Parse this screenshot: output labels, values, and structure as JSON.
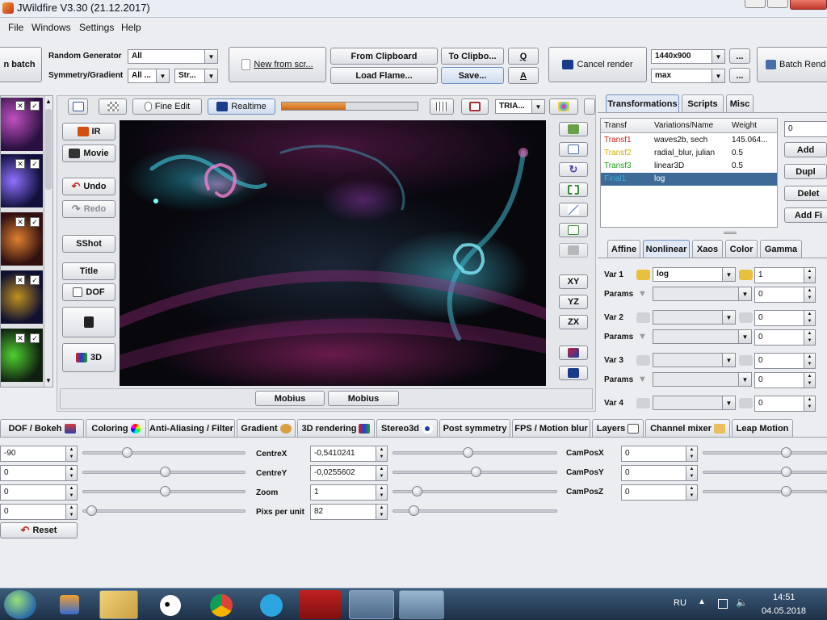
{
  "window": {
    "title": "JWildfire V3.30 (21.12.2017)"
  },
  "menu": [
    "File",
    "Windows",
    "Settings",
    "Help"
  ],
  "toolbar": {
    "batch": "n batch",
    "random_generator_label": "Random Generator",
    "random_generator_value": "All",
    "symmetry_label": "Symmetry/Gradient",
    "symmetry_value": "All ...",
    "gradient_value": "Str...",
    "new_from_script": "New from scr...",
    "from_clipboard": "From Clipboard",
    "to_clipboard": "To Clipbo...",
    "load_flame": "Load Flame...",
    "save": "Save...",
    "q": "Q",
    "a": "A",
    "cancel_render": "Cancel render",
    "resolution": "1440x900",
    "quality": "max",
    "dots": "...",
    "batch_render": "Batch Rend"
  },
  "preview_toolbar": {
    "fine_edit": "Fine Edit",
    "realtime": "Realtime",
    "progress": 0.47,
    "tria": "TRIA..."
  },
  "left_tools": {
    "ir": "IR",
    "movie": "Movie",
    "undo": "Undo",
    "redo": "Redo",
    "sshot": "SShot",
    "title": "Title",
    "dof": "DOF",
    "three_d": "3D"
  },
  "right_tools": {
    "xy": "XY",
    "yz": "YZ",
    "zx": "ZX"
  },
  "mobius": [
    "Mobius",
    "Mobius"
  ],
  "right_panel": {
    "tabs": [
      "Transformations",
      "Scripts",
      "Misc"
    ],
    "table_headers": [
      "Transf",
      "Variations/Name",
      "Weight"
    ],
    "rows": [
      {
        "transf": "Transf1",
        "name": "waves2b, sech",
        "weight": "145.064...",
        "color": "#d02020"
      },
      {
        "transf": "Transf2",
        "name": "radial_blur, julian",
        "weight": "0.5",
        "color": "#d0b000"
      },
      {
        "transf": "Transf3",
        "name": "linear3D",
        "weight": "0.5",
        "color": "#20a020"
      },
      {
        "transf": "Final1",
        "name": "log",
        "weight": "",
        "color": "#3ab0d8"
      }
    ],
    "field_value": "0",
    "buttons": [
      "Add",
      "Dupl",
      "Delet",
      "Add Fi"
    ],
    "subtabs": [
      "Affine",
      "Nonlinear",
      "Xaos",
      "Color",
      "Gamma"
    ],
    "vars": [
      {
        "label": "Var 1",
        "value": "log",
        "amount": "1",
        "params_label": "Params",
        "params_value": "0"
      },
      {
        "label": "Var 2",
        "value": "",
        "amount": "0",
        "params_label": "Params",
        "params_value": "0"
      },
      {
        "label": "Var 3",
        "value": "",
        "amount": "0",
        "params_label": "Params",
        "params_value": "0"
      },
      {
        "label": "Var 4",
        "value": "",
        "amount": "0"
      }
    ]
  },
  "bottom_tabs": [
    "DOF / Bokeh",
    "Coloring",
    "Anti-Aliasing / Filter",
    "Gradient",
    "3D rendering",
    "Stereo3d",
    "Post symmetry",
    "FPS / Motion blur",
    "Layers",
    "Channel mixer",
    "Leap Motion"
  ],
  "params": {
    "left_values": [
      "-90",
      "0",
      "0",
      "0"
    ],
    "reset": "Reset",
    "centre": [
      {
        "label": "CentreX",
        "value": "-0,5410241"
      },
      {
        "label": "CentreY",
        "value": "-0,0255602"
      },
      {
        "label": "Zoom",
        "value": "1"
      },
      {
        "label": "Pixs per unit",
        "value": "82"
      }
    ],
    "campos": [
      {
        "label": "CamPosX",
        "value": "0"
      },
      {
        "label": "CamPosY",
        "value": "0"
      },
      {
        "label": "CamPosZ",
        "value": "0"
      }
    ]
  },
  "taskbar": {
    "lang": "RU",
    "time": "14:51",
    "date": "04.05.2018"
  }
}
